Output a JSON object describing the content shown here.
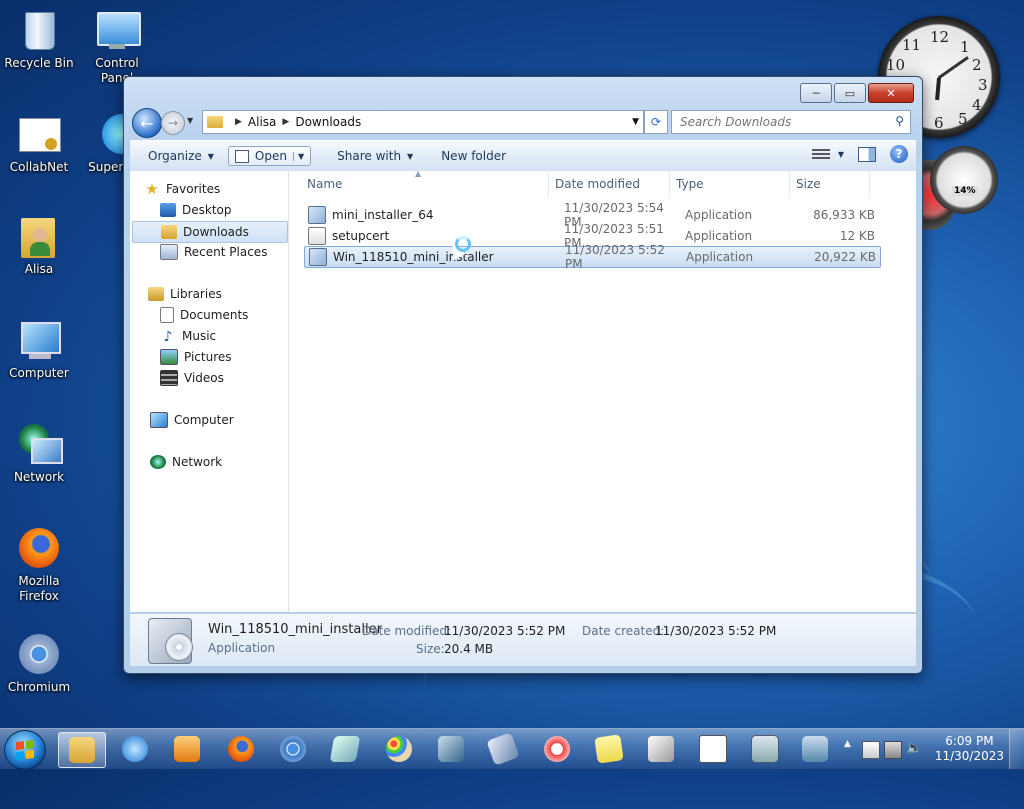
{
  "desktop": {
    "icons": [
      {
        "label": "Recycle Bin"
      },
      {
        "label": "Control Panel"
      },
      {
        "label": "CollabNet"
      },
      {
        "label": "Superr"
      },
      {
        "label": "Alisa"
      },
      {
        "label": "Computer"
      },
      {
        "label": "Network"
      },
      {
        "label": "Mozilla Firefox"
      },
      {
        "label": "Chromium"
      }
    ],
    "gadgets": {
      "clock_numbers": [
        "12",
        "1",
        "2",
        "3",
        "4",
        "5",
        "6",
        "10",
        "11"
      ],
      "cpu_percent_label": "14%"
    }
  },
  "window": {
    "caption_buttons": {
      "minimize": "─",
      "maximize": "▭",
      "close": "✕"
    },
    "breadcrumb": [
      "Alisa",
      "Downloads"
    ],
    "search_placeholder": "Search Downloads",
    "toolbar": {
      "organize": "Organize",
      "open": "Open",
      "share_with": "Share with",
      "new_folder": "New folder"
    },
    "nav": {
      "favorites": "Favorites",
      "favorites_items": [
        "Desktop",
        "Downloads",
        "Recent Places"
      ],
      "libraries": "Libraries",
      "libraries_items": [
        "Documents",
        "Music",
        "Pictures",
        "Videos"
      ],
      "computer": "Computer",
      "network": "Network",
      "selected": "Downloads"
    },
    "columns": {
      "name": "Name",
      "date": "Date modified",
      "type": "Type",
      "size": "Size"
    },
    "files": [
      {
        "name": "mini_installer_64",
        "date": "11/30/2023 5:54 PM",
        "type": "Application",
        "size": "86,933 KB"
      },
      {
        "name": "setupcert",
        "date": "11/30/2023 5:51 PM",
        "type": "Application",
        "size": "12 KB"
      },
      {
        "name": "Win_118510_mini_installer",
        "date": "11/30/2023 5:52 PM",
        "type": "Application",
        "size": "20,922 KB"
      }
    ],
    "details": {
      "name": "Win_118510_mini_installer",
      "type": "Application",
      "modified_label": "Date modified:",
      "modified_value": "11/30/2023 5:52 PM",
      "created_label": "Date created:",
      "created_value": "11/30/2023 5:52 PM",
      "size_label": "Size:",
      "size_value": "20.4 MB"
    }
  },
  "taskbar": {
    "time": "6:09 PM",
    "date": "11/30/2023"
  }
}
